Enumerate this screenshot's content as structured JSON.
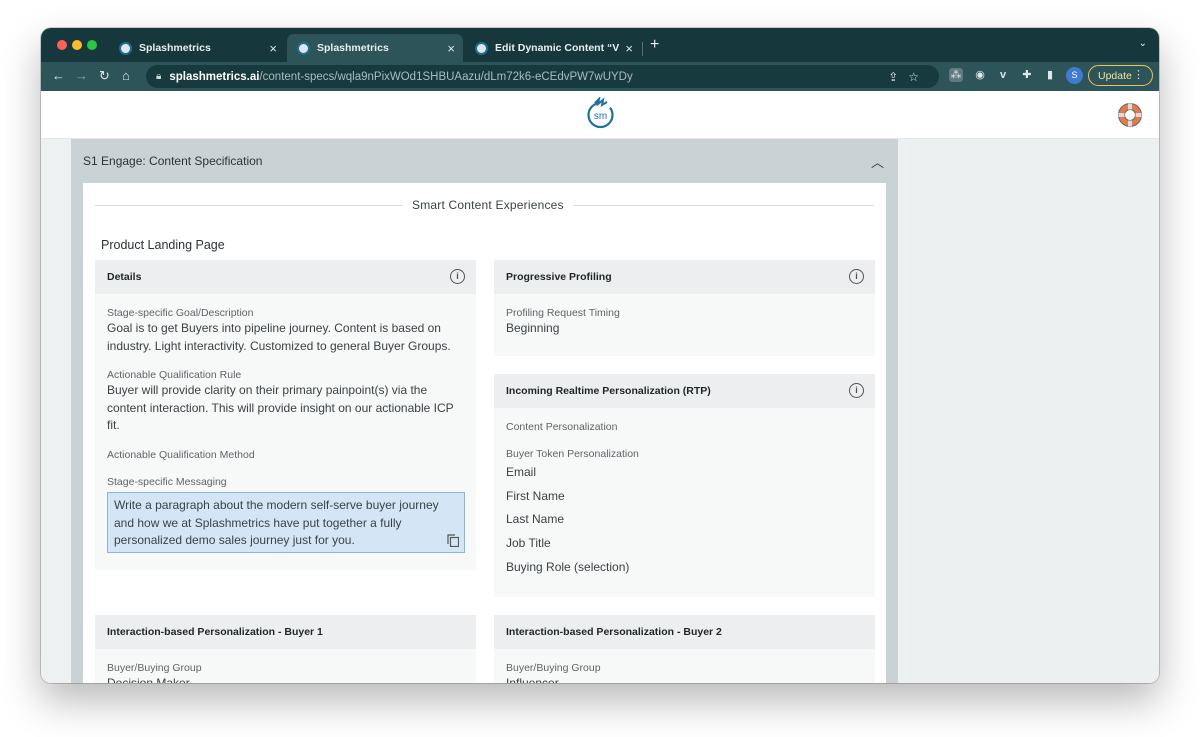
{
  "browser": {
    "tabs": [
      {
        "title": "Splashmetrics",
        "close": "×"
      },
      {
        "title": "Splashmetrics",
        "close": "×"
      },
      {
        "title": "Edit Dynamic Content “Version",
        "close": "×"
      }
    ],
    "new_tab": "+",
    "tab_menu": "⌄",
    "url_host": "splashmetrics.ai",
    "url_path": "/content-specs/wqla9nPixWOd1SHBUAazu/dLm72k6-eCEdvPW7wUYDy",
    "profile_initial": "S",
    "update_label": "Update"
  },
  "app": {
    "logo_text": "sm"
  },
  "spec": {
    "accordion_title": "S1 Engage: Content Specification",
    "section_title": "Smart Content Experiences",
    "page_name": "Product Landing Page",
    "details": {
      "title": "Details",
      "goal_label": "Stage-specific Goal/Description",
      "goal_value": "Goal is to get Buyers into pipeline journey. Content is based on industry. Light interactivity. Customized to general Buyer Groups.",
      "aq_rule_label": "Actionable Qualification Rule",
      "aq_rule_value": "Buyer will provide clarity on their primary painpoint(s) via the content interaction. This will provide insight on our actionable ICP fit.",
      "aq_method_label": "Actionable Qualification Method",
      "messaging_label": "Stage-specific Messaging",
      "messaging_value": "Write a paragraph about the modern self-serve buyer journey and how we at Splashmetrics have put together a fully personalized demo sales journey just for you."
    },
    "progressive": {
      "title": "Progressive Profiling",
      "timing_label": "Profiling Request Timing",
      "timing_value": "Beginning"
    },
    "rtp": {
      "title": "Incoming Realtime Personalization (RTP)",
      "content_label": "Content Personalization",
      "token_label": "Buyer Token Personalization",
      "tokens": [
        "Email",
        "First Name",
        "Last Name",
        "Job Title",
        "Buying Role (selection)"
      ]
    },
    "buyer1": {
      "title": "Interaction-based Personalization - Buyer 1",
      "group_label": "Buyer/Buying Group",
      "group_value": "Decision Maker"
    },
    "buyer2": {
      "title": "Interaction-based Personalization - Buyer 2",
      "group_label": "Buyer/Buying Group",
      "group_value": "Influencer"
    }
  }
}
